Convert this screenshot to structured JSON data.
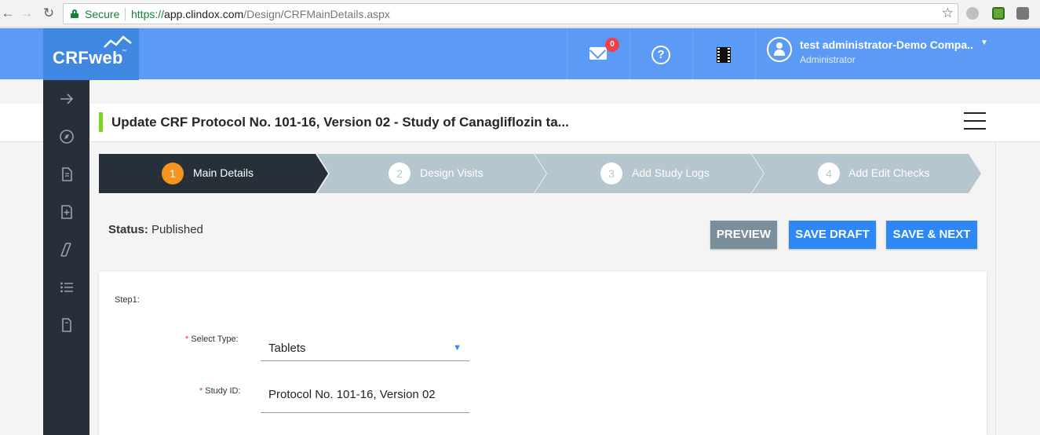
{
  "browser": {
    "secure_label": "Secure",
    "url_scheme": "https://",
    "url_host": "app.clindox.com",
    "url_path": "/Design/CRFMainDetails.aspx"
  },
  "header": {
    "logo_text": "CRFweb",
    "logo_tm": "™",
    "mail_badge": "0",
    "help_glyph": "?",
    "user_name": "test administrator-Demo Compa..",
    "user_role": "Administrator",
    "icons": [
      "mail-icon",
      "help-icon",
      "film-icon",
      "user-avatar-icon"
    ]
  },
  "sidebar": {
    "items": [
      "arrow-right-icon",
      "compass-icon",
      "document-icon",
      "add-document-icon",
      "ruler-icon",
      "list-icon",
      "page-icon"
    ]
  },
  "title_bar": {
    "title": "Update CRF Protocol No. 101-16, Version 02 - Study of Canagliflozin ta..."
  },
  "steps": [
    {
      "number": "1",
      "label": "Main Details",
      "active": true
    },
    {
      "number": "2",
      "label": "Design Visits",
      "active": false
    },
    {
      "number": "3",
      "label": "Add Study Logs",
      "active": false
    },
    {
      "number": "4",
      "label": "Add Edit Checks",
      "active": false
    }
  ],
  "status": {
    "label": "Status:",
    "value": "Published"
  },
  "actions": {
    "preview": "PREVIEW",
    "save_draft": "SAVE DRAFT",
    "save_next": "SAVE & NEXT"
  },
  "form": {
    "step_label": "Step1:",
    "required_mark": "*",
    "select_type_label": "Select Type:",
    "select_type_value": "Tablets",
    "study_id_label": "Study ID:",
    "study_id_value": "Protocol No. 101-16, Version 02"
  },
  "colors": {
    "header_blue": "#5b9bf5",
    "sidebar_dark": "#273039",
    "step_active": "#273039",
    "step_idle": "#b6c6cf",
    "step_badge": "#f5941e",
    "primary_button": "#2d87f5",
    "secondary_button": "#7a8f9b",
    "title_accent": "#7ed321"
  }
}
